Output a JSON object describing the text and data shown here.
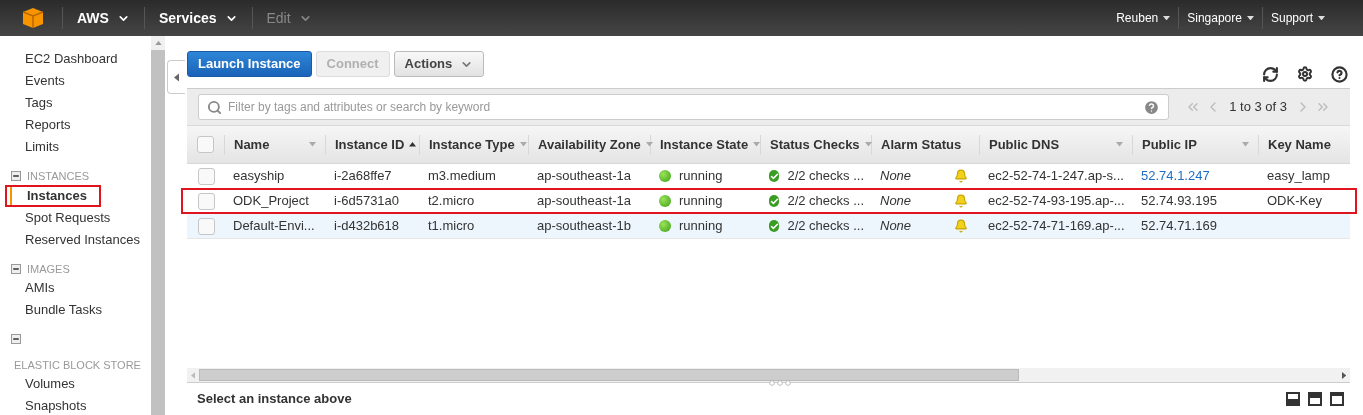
{
  "nav": {
    "menus": [
      {
        "label": "AWS",
        "disabled": false
      },
      {
        "label": "Services",
        "disabled": false
      },
      {
        "label": "Edit",
        "disabled": true
      }
    ],
    "right_menus": [
      "Reuben",
      "Singapore",
      "Support"
    ]
  },
  "sidebar": {
    "sections": [
      {
        "items": [
          {
            "label": "EC2 Dashboard",
            "selected": false,
            "annotated": false
          },
          {
            "label": "Events",
            "selected": false,
            "annotated": false
          },
          {
            "label": "Tags",
            "selected": false,
            "annotated": false
          },
          {
            "label": "Reports",
            "selected": false,
            "annotated": false
          },
          {
            "label": "Limits",
            "selected": false,
            "annotated": false
          }
        ]
      },
      {
        "header": "INSTANCES",
        "wrapped": false,
        "items": [
          {
            "label": "Instances",
            "selected": true,
            "annotated": true
          },
          {
            "label": "Spot Requests",
            "selected": false,
            "annotated": false
          },
          {
            "label": "Reserved Instances",
            "selected": false,
            "annotated": false
          }
        ]
      },
      {
        "header": "IMAGES",
        "wrapped": false,
        "items": [
          {
            "label": "AMIs",
            "selected": false,
            "annotated": false
          },
          {
            "label": "Bundle Tasks",
            "selected": false,
            "annotated": false
          }
        ]
      },
      {
        "header": "ELASTIC BLOCK STORE",
        "wrapped": true,
        "items": [
          {
            "label": "Volumes",
            "selected": false,
            "annotated": false
          },
          {
            "label": "Snapshots",
            "selected": false,
            "annotated": false
          }
        ]
      }
    ]
  },
  "toolbar": {
    "buttons": [
      {
        "label": "Launch Instance",
        "kind": "primary",
        "disabled": false,
        "dropdown": false
      },
      {
        "label": "Connect",
        "kind": "default",
        "disabled": true,
        "dropdown": false
      },
      {
        "label": "Actions",
        "kind": "default",
        "disabled": false,
        "dropdown": true
      }
    ]
  },
  "filter": {
    "placeholder": "Filter by tags and attributes or search by keyword"
  },
  "pagination": "1 to 3 of 3",
  "table": {
    "select_all_checked": false,
    "columns": [
      {
        "label": "Name",
        "sorted": false,
        "menu": true
      },
      {
        "label": "Instance ID",
        "sorted": true,
        "menu": false
      },
      {
        "label": "Instance Type",
        "sorted": false,
        "menu": true
      },
      {
        "label": "Availability Zone",
        "sorted": false,
        "menu": true
      },
      {
        "label": "Instance State",
        "sorted": false,
        "menu": true
      },
      {
        "label": "Status Checks",
        "sorted": false,
        "menu": true
      },
      {
        "label": "Alarm Status",
        "sorted": false,
        "menu": false
      },
      {
        "label": "Public DNS",
        "sorted": false,
        "menu": true
      },
      {
        "label": "Public IP",
        "sorted": false,
        "menu": true
      },
      {
        "label": "Key Name",
        "sorted": false,
        "menu": false
      }
    ],
    "rows": [
      {
        "checked": false,
        "hovered": false,
        "annotated": false,
        "name": "easyship",
        "instance_id": "i-2a68ffe7",
        "instance_type": "m3.medium",
        "availability_zone": "ap-southeast-1a",
        "instance_state": "running",
        "status_checks": "2/2 checks ...",
        "alarm_status": "None",
        "public_dns": "ec2-52-74-1-247.ap-s...",
        "public_ip": "52.74.1.247",
        "ip_link": true,
        "key_name": "easy_lamp"
      },
      {
        "checked": false,
        "hovered": false,
        "annotated": true,
        "name": "ODK_Project",
        "instance_id": "i-6d5731a0",
        "instance_type": "t2.micro",
        "availability_zone": "ap-southeast-1a",
        "instance_state": "running",
        "status_checks": "2/2 checks ...",
        "alarm_status": "None",
        "public_dns": "ec2-52-74-93-195.ap-...",
        "public_ip": "52.74.93.195",
        "ip_link": false,
        "key_name": "ODK-Key"
      },
      {
        "checked": false,
        "hovered": true,
        "annotated": false,
        "name": "Default-Envi...",
        "instance_id": "i-d432b618",
        "instance_type": "t1.micro",
        "availability_zone": "ap-southeast-1b",
        "instance_state": "running",
        "status_checks": "2/2 checks ...",
        "alarm_status": "None",
        "public_dns": "ec2-52-74-71-169.ap-...",
        "public_ip": "52.74.71.169",
        "ip_link": false
      }
    ]
  },
  "details": {
    "message": "Select an instance above"
  }
}
